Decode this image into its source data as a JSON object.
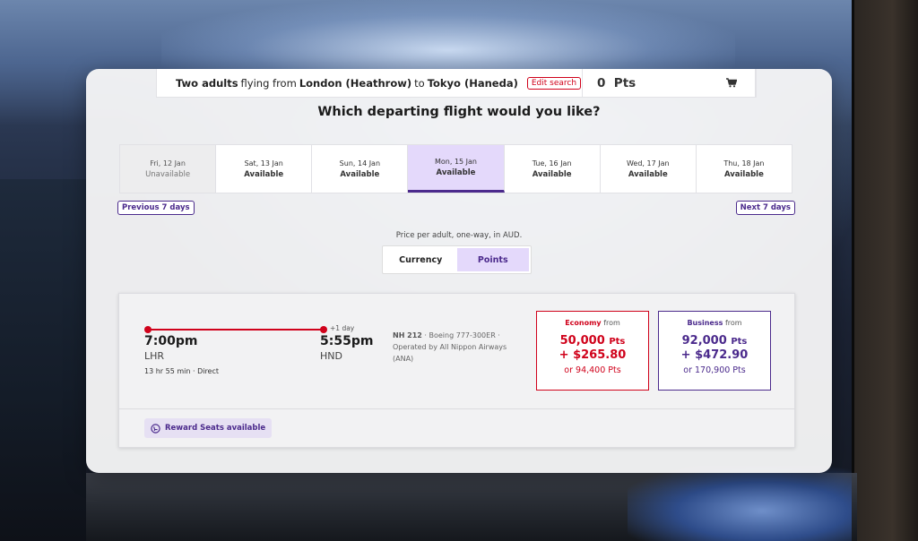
{
  "search": {
    "passengers": "Two adults",
    "flying_from_text": "flying from",
    "origin": "London (Heathrow)",
    "to_text": "to",
    "destination": "Tokyo (Haneda)",
    "edit_label": "Edit search"
  },
  "points_balance": "0  Pts",
  "page_title": "Which departing flight would you like?",
  "dates": [
    {
      "date": "Fri, 12 Jan",
      "status": "Unavailable"
    },
    {
      "date": "Sat, 13 Jan",
      "status": "Available"
    },
    {
      "date": "Sun, 14 Jan",
      "status": "Available"
    },
    {
      "date": "Mon, 15 Jan",
      "status": "Available"
    },
    {
      "date": "Tue, 16 Jan",
      "status": "Available"
    },
    {
      "date": "Wed, 17 Jan",
      "status": "Available"
    },
    {
      "date": "Thu, 18 Jan",
      "status": "Available"
    }
  ],
  "nav": {
    "prev_label": "Previous 7 days",
    "next_label": "Next 7 days"
  },
  "price_note": "Price per adult, one-way, in AUD.",
  "toggle": {
    "currency_label": "Currency",
    "points_label": "Points",
    "selected": "Points"
  },
  "flight": {
    "departure_time": "7:00pm",
    "departure_code": "LHR",
    "arrival_time": "5:55pm",
    "arrival_code": "HND",
    "day_offset": "+1 day",
    "duration": "13 hr 55 min · Direct",
    "flight_number": "NH 212",
    "aircraft": " · Boeing 777-300ER ·",
    "operator": "Operated by All Nippon Airways (ANA)",
    "reward_badge": "Reward Seats available"
  },
  "fares": {
    "economy": {
      "class": "Economy",
      "from": "from",
      "points": "50,000",
      "points_unit": "Pts",
      "cash": "+ $265.80",
      "alt": "or 94,400 Pts"
    },
    "business": {
      "class": "Business",
      "from": "from",
      "points": "92,000",
      "points_unit": "Pts",
      "cash": "+ $472.90",
      "alt": "or 170,900 Pts"
    }
  },
  "colors": {
    "accent_purple": "#4b2a8c",
    "accent_red": "#d0021b",
    "selected_bg": "#e4d9fb"
  }
}
